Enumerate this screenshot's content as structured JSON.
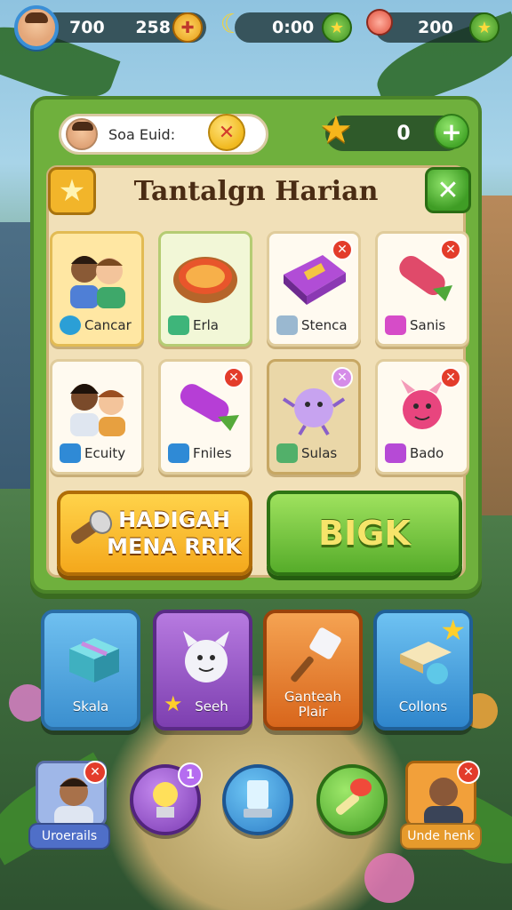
{
  "hud": {
    "coins": "700",
    "gems": "258",
    "timer": "0:00",
    "energy": "200",
    "icons": [
      "avatar",
      "cross-coin-icon",
      "banana-icon",
      "star-coin-icon",
      "lollipop-icon",
      "star-coin-icon"
    ]
  },
  "panel": {
    "player_name": "Soa Euid:",
    "score": "0",
    "title": "Tantalgn Harian",
    "close_glyph": "✕",
    "plus_glyph": "+"
  },
  "cards": [
    {
      "label": "Cancar",
      "style": "gold",
      "removable": false
    },
    {
      "label": "Erla",
      "style": "green",
      "removable": false
    },
    {
      "label": "Stenca",
      "style": "plain",
      "removable": true
    },
    {
      "label": "Sanis",
      "style": "plain",
      "removable": true
    },
    {
      "label": "Ecuity",
      "style": "plain",
      "removable": false
    },
    {
      "label": "Fniles",
      "style": "plain",
      "removable": true
    },
    {
      "label": "Sulas",
      "style": "tan",
      "removable": true
    },
    {
      "label": "Bado",
      "style": "plain",
      "removable": true
    }
  ],
  "buttons": {
    "left_line1": "HADIGAH",
    "left_line2": "MENA RRIK",
    "right": "BIGK"
  },
  "tiles": [
    {
      "label": "Skala",
      "color": "#4da3db"
    },
    {
      "label": "Seeh",
      "color": "#9a55c8"
    },
    {
      "label": "Ganteah\nPlair",
      "color": "#ea8634"
    },
    {
      "label": "Collons",
      "color": "#3e9ad8"
    }
  ],
  "nav": {
    "left_tag": "Uroerails",
    "right_tag": "Unde henk",
    "badge_count": "1"
  }
}
